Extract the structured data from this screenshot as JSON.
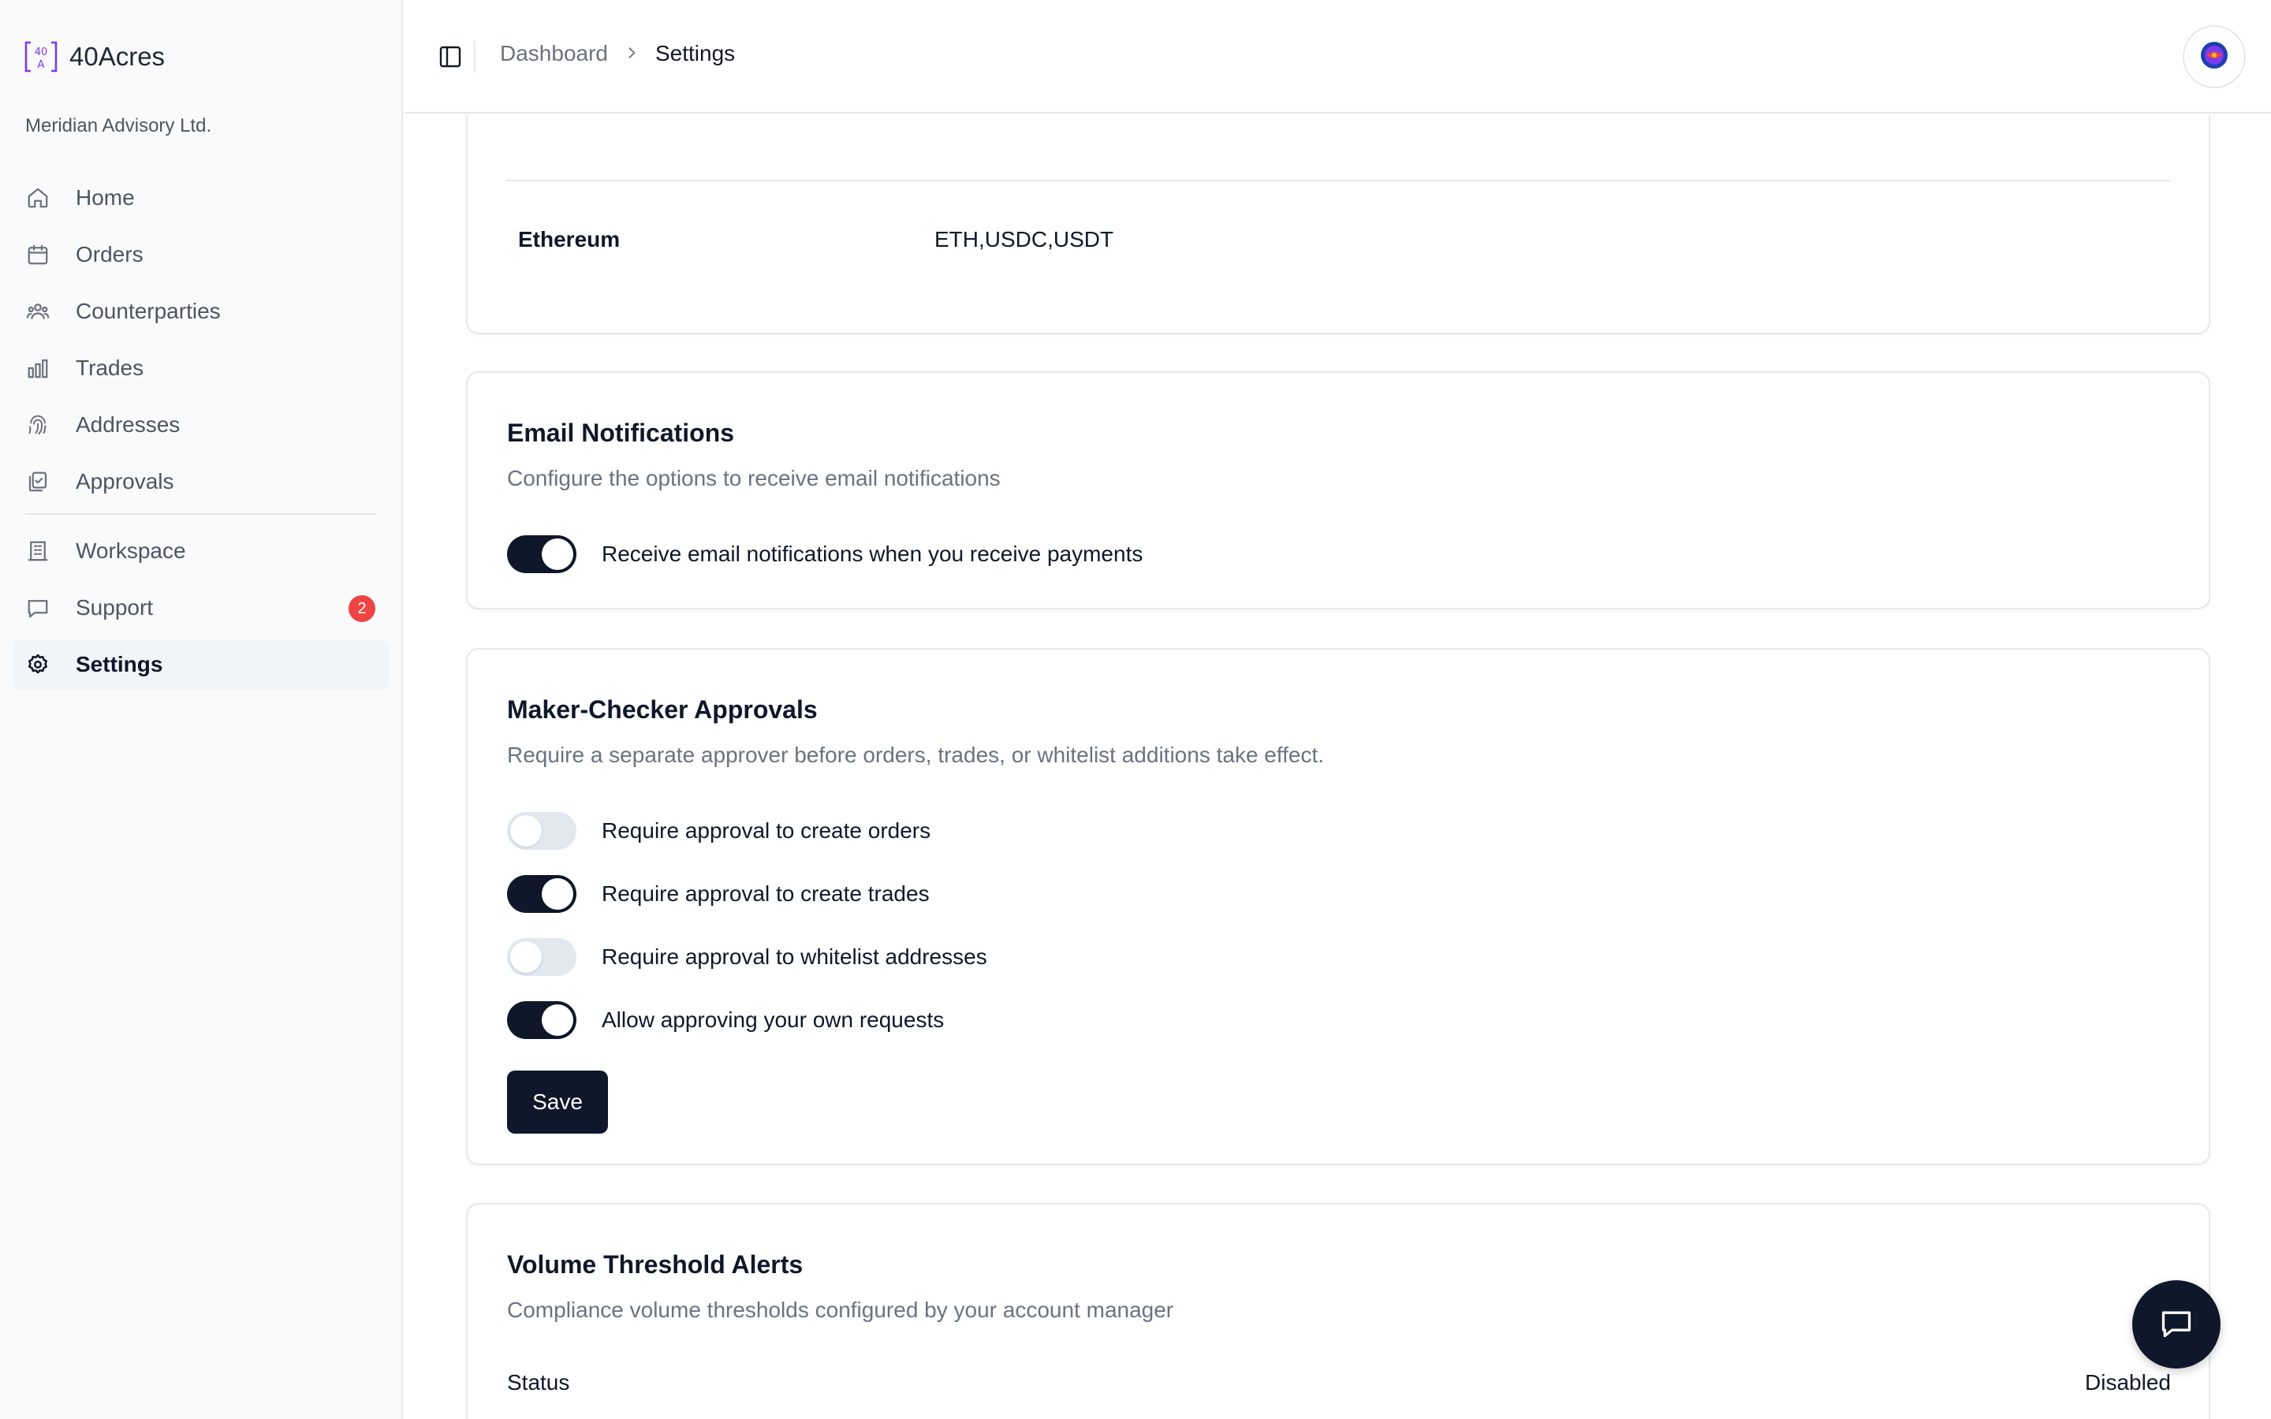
{
  "brand": {
    "name": "40Acres",
    "org": "Meridian Advisory Ltd."
  },
  "sidebar": {
    "items": [
      {
        "label": "Home",
        "icon": "home-icon"
      },
      {
        "label": "Orders",
        "icon": "calendar-icon"
      },
      {
        "label": "Counterparties",
        "icon": "users-icon"
      },
      {
        "label": "Trades",
        "icon": "bar-chart-icon"
      },
      {
        "label": "Addresses",
        "icon": "fingerprint-icon"
      },
      {
        "label": "Approvals",
        "icon": "clipboard-check-icon"
      }
    ],
    "secondary": [
      {
        "label": "Workspace",
        "icon": "building-icon"
      },
      {
        "label": "Support",
        "icon": "message-square-icon",
        "badge": "2"
      },
      {
        "label": "Settings",
        "icon": "gear-icon",
        "active": true
      }
    ]
  },
  "header": {
    "breadcrumb": [
      "Dashboard",
      "Settings"
    ]
  },
  "networks": {
    "rows": [
      {
        "network": "Ethereum",
        "tokens": "ETH,USDC,USDT"
      }
    ]
  },
  "email": {
    "title": "Email Notifications",
    "subtitle": "Configure the options to receive email notifications",
    "toggles": [
      {
        "label": "Receive email notifications when you receive payments",
        "on": true
      }
    ]
  },
  "maker_checker": {
    "title": "Maker-Checker Approvals",
    "subtitle": "Require a separate approver before orders, trades, or whitelist additions take effect.",
    "toggles": [
      {
        "label": "Require approval to create orders",
        "on": false
      },
      {
        "label": "Require approval to create trades",
        "on": true
      },
      {
        "label": "Require approval to whitelist addresses",
        "on": false
      },
      {
        "label": "Allow approving your own requests",
        "on": true
      }
    ],
    "save_label": "Save"
  },
  "volume": {
    "title": "Volume Threshold Alerts",
    "subtitle": "Compliance volume thresholds configured by your account manager",
    "status_label": "Status",
    "status_value": "Disabled"
  },
  "colors": {
    "primary": "#0f172a",
    "badge": "#ef4444",
    "brand": "#7c3aed"
  }
}
